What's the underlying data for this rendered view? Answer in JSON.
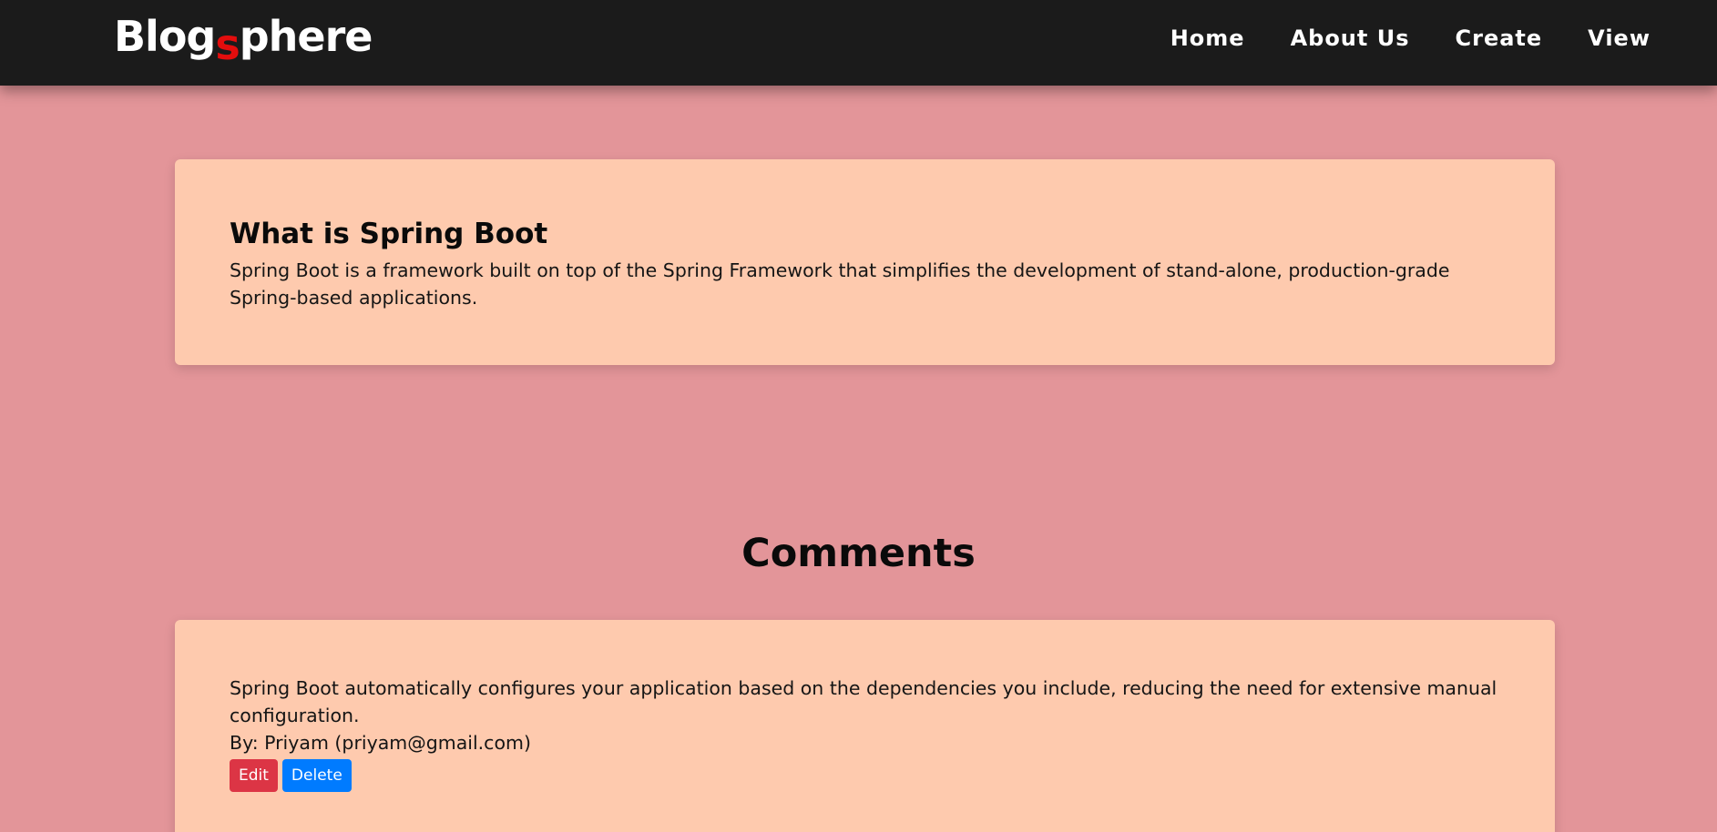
{
  "header": {
    "brand": {
      "part1": "Blog",
      "part2": "s",
      "part3": "phere"
    },
    "nav": [
      {
        "label": "Home"
      },
      {
        "label": "About Us"
      },
      {
        "label": "Create"
      },
      {
        "label": "View"
      }
    ]
  },
  "post": {
    "title": "What is Spring Boot",
    "body": "Spring Boot is a framework built on top of the Spring Framework that simplifies the development of stand-alone, production-grade Spring-based applications."
  },
  "comments": {
    "heading": "Comments",
    "items": [
      {
        "text": "Spring Boot automatically configures your application based on the dependencies you include, reducing the need for extensive manual configuration.",
        "author": "By: Priyam (priyam@gmail.com)",
        "edit_label": "Edit",
        "delete_label": "Delete"
      }
    ]
  },
  "colors": {
    "page_background": "#e39599",
    "navbar_background": "#1b1b1b",
    "card_background": "#fecaae",
    "brand_accent": "#e30d0d",
    "edit_button": "#dc3545",
    "delete_button": "#007bff"
  }
}
